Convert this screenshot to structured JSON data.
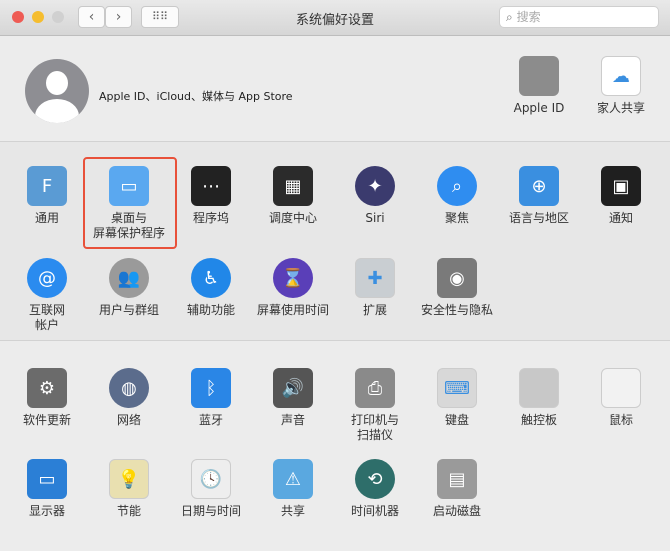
{
  "window": {
    "title": "系统偏好设置",
    "search_placeholder": "搜索"
  },
  "traffic_lights": [
    "#ee5b54",
    "#f5bd2f",
    "#d0d0d0"
  ],
  "account": {
    "label": "Apple ID、iCloud、媒体与 App Store",
    "items": [
      {
        "label": "Apple ID",
        "icon": "apple-icon",
        "color": "#8c8c8c",
        "glyph": ""
      },
      {
        "label": "家人共享",
        "icon": "family-sharing-icon",
        "color": "#ffffff",
        "glyph": "☁"
      }
    ]
  },
  "rows": [
    [
      {
        "label": "通用",
        "icon": "general-icon",
        "color": "#5a9bd4",
        "glyph": "F"
      },
      {
        "label": "桌面与\n屏幕保护程序",
        "icon": "desktop-screensaver-icon",
        "color": "#5aa8f0",
        "glyph": "▭"
      },
      {
        "label": "程序坞",
        "icon": "dock-icon",
        "color": "#222222",
        "glyph": "⋯"
      },
      {
        "label": "调度中心",
        "icon": "mission-control-icon",
        "color": "#2b2b2b",
        "glyph": "▦"
      },
      {
        "label": "Siri",
        "icon": "siri-icon",
        "color": "#3b3b6e",
        "glyph": "✦"
      },
      {
        "label": "聚焦",
        "icon": "spotlight-icon",
        "color": "#2f8df0",
        "glyph": "⌕"
      },
      {
        "label": "语言与地区",
        "icon": "language-region-icon",
        "color": "#3a8fe0",
        "glyph": "⊕"
      },
      {
        "label": "通知",
        "icon": "notifications-icon",
        "color": "#1f1f1f",
        "glyph": "▣"
      }
    ],
    [
      {
        "label": "互联网\n帐户",
        "icon": "internet-accounts-icon",
        "color": "#2a8bef",
        "glyph": "@"
      },
      {
        "label": "用户与群组",
        "icon": "users-groups-icon",
        "color": "#9a9a9a",
        "glyph": "👥"
      },
      {
        "label": "辅助功能",
        "icon": "accessibility-icon",
        "color": "#2187e8",
        "glyph": "♿"
      },
      {
        "label": "屏幕使用时间",
        "icon": "screen-time-icon",
        "color": "#5a3fb8",
        "glyph": "⌛"
      },
      {
        "label": "扩展",
        "icon": "extensions-icon",
        "color": "#c9ced2",
        "glyph": "✚"
      },
      {
        "label": "安全性与隐私",
        "icon": "security-privacy-icon",
        "color": "#7a7a7a",
        "glyph": "◉"
      }
    ],
    [
      {
        "label": "软件更新",
        "icon": "software-update-icon",
        "color": "#6b6b6b",
        "glyph": "⚙"
      },
      {
        "label": "网络",
        "icon": "network-icon",
        "color": "#5b6c8c",
        "glyph": "◍"
      },
      {
        "label": "蓝牙",
        "icon": "bluetooth-icon",
        "color": "#2a86e6",
        "glyph": "ᛒ"
      },
      {
        "label": "声音",
        "icon": "sound-icon",
        "color": "#555555",
        "glyph": "🔊"
      },
      {
        "label": "打印机与\n扫描仪",
        "icon": "printers-scanners-icon",
        "color": "#8a8a8a",
        "glyph": "⎙"
      },
      {
        "label": "键盘",
        "icon": "keyboard-icon",
        "color": "#d8d8d8",
        "glyph": "⌨"
      },
      {
        "label": "触控板",
        "icon": "trackpad-icon",
        "color": "#c8c8c8",
        "glyph": ""
      },
      {
        "label": "鼠标",
        "icon": "mouse-icon",
        "color": "#f2f2f2",
        "glyph": ""
      }
    ],
    [
      {
        "label": "显示器",
        "icon": "displays-icon",
        "color": "#2b7fd6",
        "glyph": "▭"
      },
      {
        "label": "节能",
        "icon": "energy-saver-icon",
        "color": "#e9e0b0",
        "glyph": "💡"
      },
      {
        "label": "日期与时间",
        "icon": "date-time-icon",
        "color": "#eeeeee",
        "glyph": "🕓"
      },
      {
        "label": "共享",
        "icon": "sharing-icon",
        "color": "#5aa8e0",
        "glyph": "⚠"
      },
      {
        "label": "时间机器",
        "icon": "time-machine-icon",
        "color": "#2e6e6a",
        "glyph": "⟲"
      },
      {
        "label": "启动磁盘",
        "icon": "startup-disk-icon",
        "color": "#9a9a9a",
        "glyph": "▤"
      }
    ]
  ]
}
